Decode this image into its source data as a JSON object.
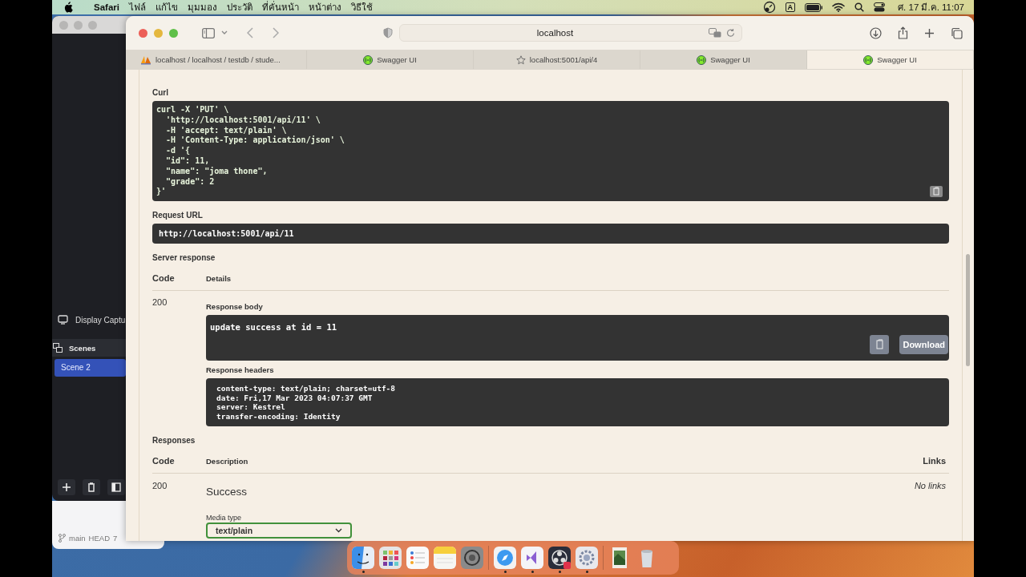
{
  "menu_bar": {
    "app": "Safari",
    "items": [
      "ไฟล์",
      "แก้ไข",
      "มุมมอง",
      "ประวัติ",
      "ที่คั่นหน้า",
      "หน้าต่าง",
      "วิธีใช้"
    ],
    "input_source": "A",
    "clock": "ศ. 17 มี.ค. 11:07"
  },
  "obs_window": {
    "source": "Display Captu",
    "section": "Scenes",
    "scenes": [
      {
        "name": "Scene 2",
        "selected": true
      }
    ]
  },
  "git_bar": {
    "branch": "main",
    "head": "HEAD",
    "count": "7"
  },
  "browser": {
    "address": "localhost",
    "tabs": [
      {
        "label": "localhost / localhost / testdb / stude...",
        "kind": "pma",
        "selected": false
      },
      {
        "label": "Swagger UI",
        "kind": "swagger",
        "selected": false
      },
      {
        "label": "localhost:5001/api/4",
        "kind": "star",
        "selected": false
      },
      {
        "label": "Swagger UI",
        "kind": "swagger",
        "selected": false
      },
      {
        "label": "Swagger UI",
        "kind": "swagger",
        "selected": true
      }
    ]
  },
  "curl": {
    "label": "Curl",
    "lines": [
      "curl -X 'PUT' \\",
      "  'http://localhost:5001/api/11' \\",
      "  -H 'accept: text/plain' \\",
      "  -H 'Content-Type: application/json' \\",
      "  -d '{",
      "  \"id\": 11,",
      "  \"name\": \"joma thone\",",
      "  \"grade\": 2",
      "}'"
    ]
  },
  "request_url": {
    "label": "Request URL",
    "value": "http://localhost:5001/api/11"
  },
  "server_response": {
    "label": "Server response",
    "columns": [
      "Code",
      "Details"
    ],
    "code": "200",
    "body_label": "Response body",
    "body": "update success at id = 11",
    "download": "Download",
    "headers_label": "Response headers",
    "headers": [
      "content-type: text/plain; charset=utf-8",
      "date: Fri,17 Mar 2023 04:07:37 GMT",
      "server: Kestrel",
      "transfer-encoding: Identity"
    ]
  },
  "responses": {
    "label": "Responses",
    "columns": [
      "Code",
      "Description",
      "Links"
    ],
    "rows": [
      {
        "code": "200",
        "description": "Success",
        "links": "No links",
        "media_type_label": "Media type",
        "media_type": "text/plain"
      }
    ]
  },
  "dock": [
    {
      "kind": "finder",
      "running": true
    },
    {
      "kind": "launchpad",
      "running": false
    },
    {
      "kind": "reminders",
      "running": false
    },
    {
      "kind": "notes",
      "running": false
    },
    {
      "kind": "settings",
      "running": false
    },
    {
      "kind": "sep"
    },
    {
      "kind": "safari",
      "running": true
    },
    {
      "kind": "vs",
      "running": true
    },
    {
      "kind": "obs",
      "running": true
    },
    {
      "kind": "gear",
      "running": true
    },
    {
      "kind": "sep"
    },
    {
      "kind": "photo",
      "running": false
    },
    {
      "kind": "trash",
      "running": false
    }
  ]
}
